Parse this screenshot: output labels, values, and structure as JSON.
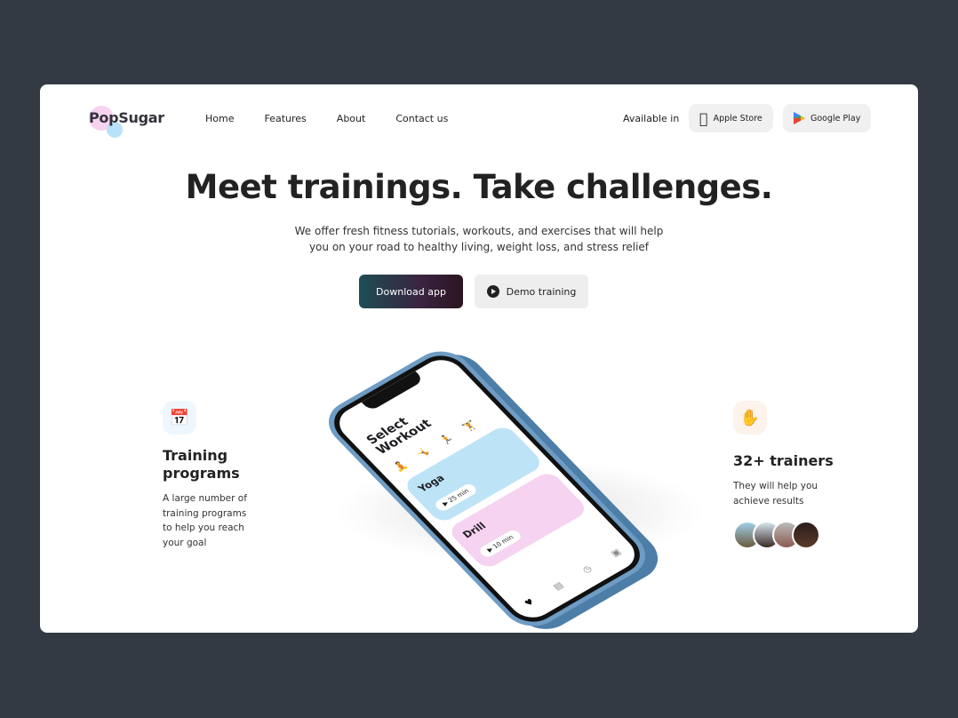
{
  "brand": {
    "name": "PopSugar"
  },
  "nav": {
    "items": [
      "Home",
      "Features",
      "About",
      "Contact us"
    ]
  },
  "stores": {
    "available_label": "Available in",
    "apple": "Apple Store",
    "google": "Google Play"
  },
  "hero": {
    "title": "Meet trainings. Take challenges.",
    "subtitle_line1": "We offer fresh fitness tutorials, workouts, and exercises that will help",
    "subtitle_line2": "you on your road to healthy living, weight loss, and stress relief",
    "download": "Download app",
    "demo": "Demo training"
  },
  "phone": {
    "title_line1": "Select",
    "title_line2": "Workout",
    "cards": [
      {
        "name": "Yoga",
        "duration": "25 min"
      },
      {
        "name": "Drill",
        "duration": "10 min"
      }
    ]
  },
  "features": [
    {
      "icon": "calendar-dumbbell-icon",
      "title_line1": "Training",
      "title_line2": "programs",
      "text": [
        "A large number of",
        "training programs",
        "to help you reach",
        "your goal"
      ]
    },
    {
      "icon": "hand-dumbbell-icon",
      "title": "32+ trainers",
      "text": [
        "They will help you",
        "achieve results"
      ]
    }
  ],
  "colors": {
    "background": "#343a43",
    "accent_blue": "#3aa0e8",
    "accent_orange": "#f0582a",
    "yoga_card": "#bde3f7",
    "drill_card": "#f6d3f0"
  }
}
